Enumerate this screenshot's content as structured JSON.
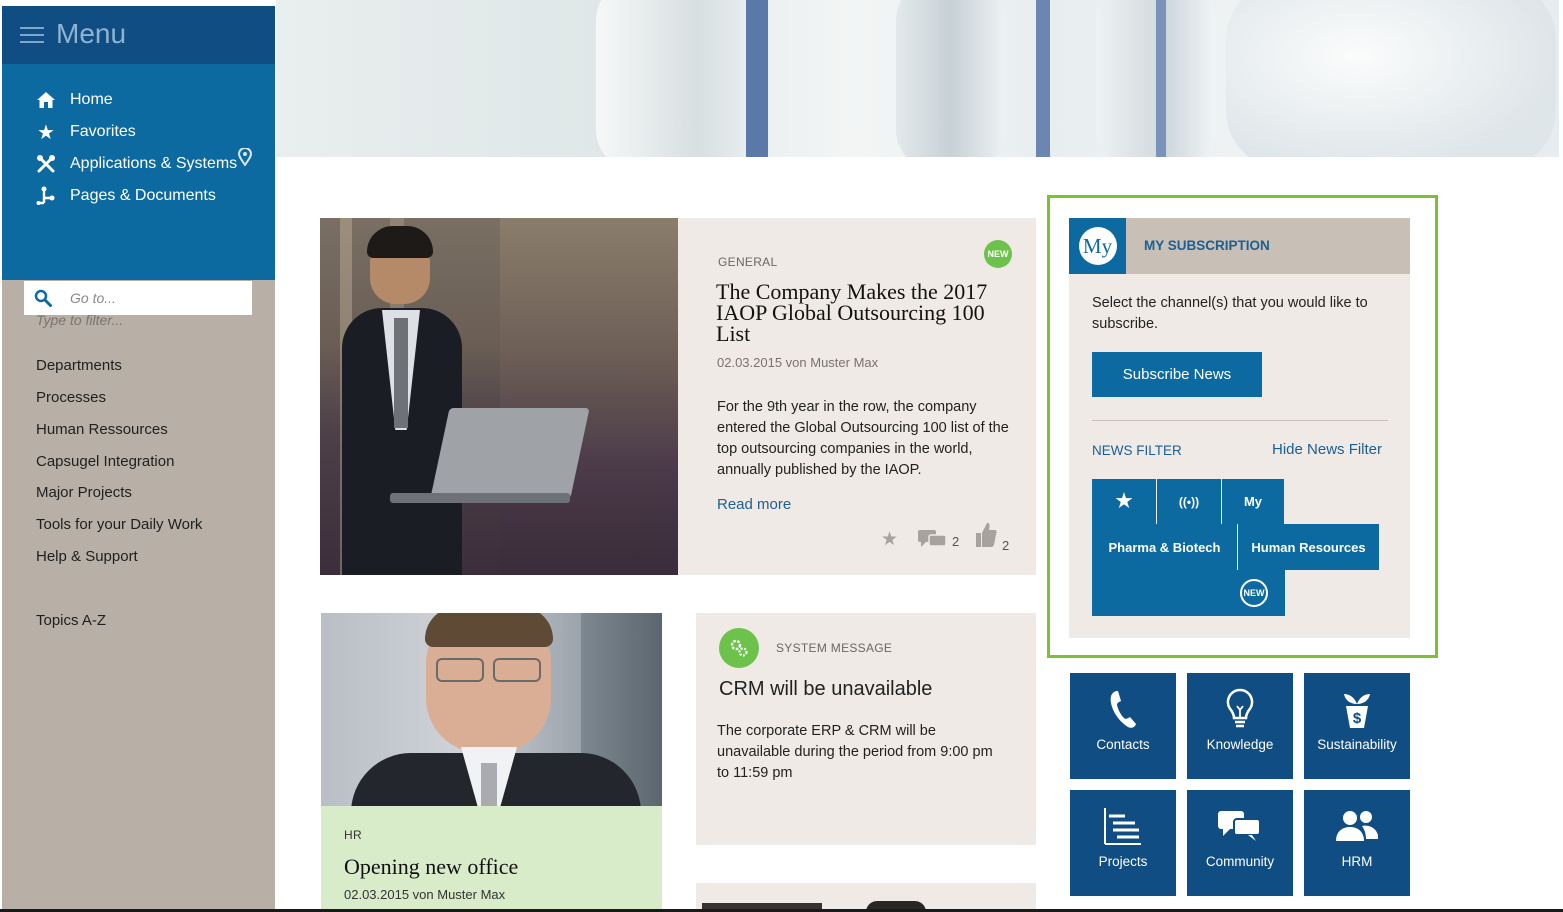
{
  "sidebar": {
    "menu_title": "Menu",
    "nav": [
      {
        "label": "Home",
        "icon": "home-icon"
      },
      {
        "label": "Favorites",
        "icon": "star-icon"
      },
      {
        "label": "Applications & Systems",
        "icon": "tools-icon"
      },
      {
        "label": "Pages & Documents",
        "icon": "sitemap-icon"
      }
    ],
    "goto_placeholder": "Go to...",
    "filter_placeholder": "Type to filter...",
    "departments": [
      "Departments",
      "Processes",
      "Human Ressources",
      "Capsugel Integration",
      "Major Projects",
      "Tools for your Daily Work",
      "Help & Support"
    ],
    "topics": "Topics A-Z"
  },
  "feature": {
    "category": "GENERAL",
    "badge": "NEW",
    "title": "The Company Makes the 2017 IAOP Global Outsourcing 100 List",
    "meta": "02.03.2015 von Muster Max",
    "body": "For the 9th year in the row, the company entered the Global Outsourcing 100 list of the top outsourcing companies in the world, annually published by the IAOP.",
    "read_more": "Read more",
    "comments": "2",
    "likes": "2"
  },
  "hr_card": {
    "category": "HR",
    "title": "Opening new office",
    "meta": "02.03.2015 von Muster Max"
  },
  "system_card": {
    "category": "SYSTEM MESSAGE",
    "title": "CRM will be unavailable",
    "body": "The corporate ERP & CRM will be unavailable during the period from 9:00 pm to 11:59 pm"
  },
  "subscription": {
    "my_label": "My",
    "title": "MY SUBSCRIPTION",
    "intro": "Select the channel(s) that you would like to subscribe.",
    "button": "Subscribe News",
    "filter_label": "NEWS FILTER",
    "hide_link": "Hide News Filter",
    "chips": {
      "star": "★",
      "broadcast": "((•))",
      "my": "My",
      "pharma": "Pharma & Biotech",
      "hr": "Human Resources",
      "new": "NEW"
    }
  },
  "tiles": [
    {
      "label": "Contacts",
      "icon": "phone-icon"
    },
    {
      "label": "Knowledge",
      "icon": "lightbulb-icon"
    },
    {
      "label": "Sustainability",
      "icon": "plant-money-icon"
    },
    {
      "label": "Projects",
      "icon": "list-icon"
    },
    {
      "label": "Community",
      "icon": "chat-icon"
    },
    {
      "label": "HRM",
      "icon": "users-icon"
    }
  ],
  "colors": {
    "primary_blue": "#0d6aa1",
    "dark_blue": "#0f4d82",
    "accent_green": "#6cc24a",
    "highlight_outline": "#7ac231",
    "sidebar_bg": "#b8b0a7",
    "card_bg": "#efeae5"
  }
}
